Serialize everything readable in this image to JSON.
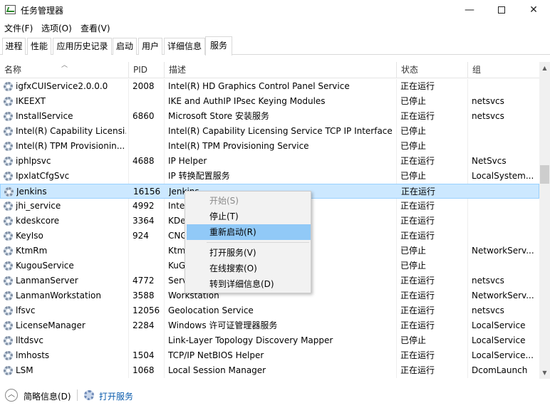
{
  "window": {
    "title": "任务管理器",
    "min_glyph": "—",
    "close_glyph": "✕"
  },
  "menu": [
    {
      "label": "文件(F)"
    },
    {
      "label": "选项(O)"
    },
    {
      "label": "查看(V)"
    }
  ],
  "tabs": [
    {
      "label": "进程"
    },
    {
      "label": "性能"
    },
    {
      "label": "应用历史记录"
    },
    {
      "label": "启动"
    },
    {
      "label": "用户"
    },
    {
      "label": "详细信息"
    },
    {
      "label": "服务",
      "active": true
    }
  ],
  "columns": {
    "name": "名称",
    "pid": "PID",
    "desc": "描述",
    "status": "状态",
    "group": "组"
  },
  "rows": [
    {
      "name": "igfxCUIService2.0.0.0",
      "pid": "2008",
      "desc": "Intel(R) HD Graphics Control Panel Service",
      "status": "正在运行",
      "group": ""
    },
    {
      "name": "IKEEXT",
      "pid": "",
      "desc": "IKE and AuthIP IPsec Keying Modules",
      "status": "已停止",
      "group": "netsvcs"
    },
    {
      "name": "InstallService",
      "pid": "6860",
      "desc": "Microsoft Store 安装服务",
      "status": "正在运行",
      "group": "netsvcs"
    },
    {
      "name": "Intel(R) Capability Licensi...",
      "pid": "",
      "desc": "Intel(R) Capability Licensing Service TCP IP Interface",
      "status": "已停止",
      "group": ""
    },
    {
      "name": "Intel(R) TPM Provisionin...",
      "pid": "",
      "desc": "Intel(R) TPM Provisioning Service",
      "status": "已停止",
      "group": ""
    },
    {
      "name": "iphlpsvc",
      "pid": "4688",
      "desc": "IP Helper",
      "status": "正在运行",
      "group": "NetSvcs"
    },
    {
      "name": "IpxlatCfgSvc",
      "pid": "",
      "desc": "IP 转换配置服务",
      "status": "已停止",
      "group": "LocalSystem..."
    },
    {
      "name": "Jenkins",
      "pid": "16156",
      "desc": "Jenkins",
      "status": "正在运行",
      "group": "",
      "selected": true
    },
    {
      "name": "jhi_service",
      "pid": "4992",
      "desc": "Inte                                      r Host Interface ...",
      "status": "正在运行",
      "group": ""
    },
    {
      "name": "kdeskcore",
      "pid": "3364",
      "desc": "KDe",
      "status": "正在运行",
      "group": ""
    },
    {
      "name": "KeyIso",
      "pid": "924",
      "desc": "CNG",
      "status": "正在运行",
      "group": ""
    },
    {
      "name": "KtmRm",
      "pid": "",
      "desc": "Ktm                                        Coordinator",
      "status": "已停止",
      "group": "NetworkServ..."
    },
    {
      "name": "KugouService",
      "pid": "",
      "desc": "KuG",
      "status": "已停止",
      "group": ""
    },
    {
      "name": "LanmanServer",
      "pid": "4772",
      "desc": "Serv",
      "status": "正在运行",
      "group": "netsvcs"
    },
    {
      "name": "LanmanWorkstation",
      "pid": "3588",
      "desc": "Workstation",
      "status": "正在运行",
      "group": "NetworkServ..."
    },
    {
      "name": "lfsvc",
      "pid": "12056",
      "desc": "Geolocation Service",
      "status": "正在运行",
      "group": "netsvcs"
    },
    {
      "name": "LicenseManager",
      "pid": "2284",
      "desc": "Windows 许可证管理器服务",
      "status": "正在运行",
      "group": "LocalService"
    },
    {
      "name": "lltdsvc",
      "pid": "",
      "desc": "Link-Layer Topology Discovery Mapper",
      "status": "已停止",
      "group": "LocalService"
    },
    {
      "name": "lmhosts",
      "pid": "1504",
      "desc": "TCP/IP NetBIOS Helper",
      "status": "正在运行",
      "group": "LocalService..."
    },
    {
      "name": "LSM",
      "pid": "1068",
      "desc": "Local Session Manager",
      "status": "正在运行",
      "group": "DcomLaunch"
    }
  ],
  "context_menu": [
    {
      "label": "开始(S)",
      "disabled": true
    },
    {
      "label": "停止(T)"
    },
    {
      "label": "重新启动(R)",
      "highlight": true
    },
    {
      "label": "打开服务(V)"
    },
    {
      "label": "在线搜索(O)"
    },
    {
      "label": "转到详细信息(D)"
    }
  ],
  "footer": {
    "brief": "简略信息(D)",
    "open_services": "打开服务"
  }
}
